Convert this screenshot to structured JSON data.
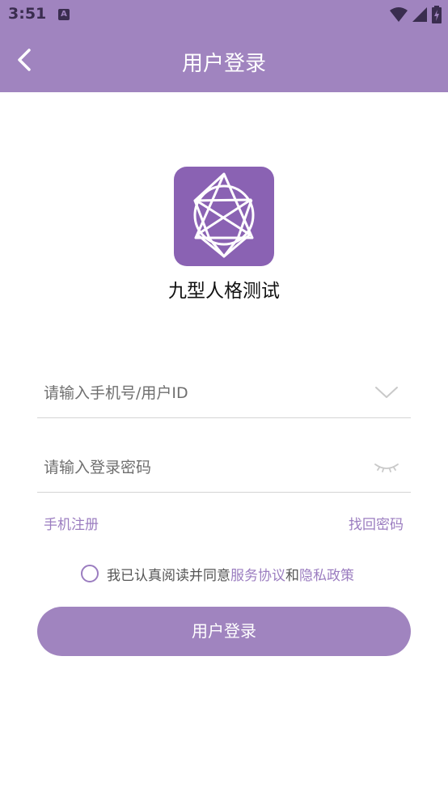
{
  "status_bar": {
    "time": "3:51",
    "notification_letter": "A"
  },
  "header": {
    "title": "用户登录"
  },
  "app": {
    "name": "九型人格测试"
  },
  "form": {
    "phone_placeholder": "请输入手机号/用户ID",
    "password_placeholder": "请输入登录密码"
  },
  "links": {
    "register": "手机注册",
    "forgot": "找回密码"
  },
  "agreement": {
    "prefix": "我已认真阅读并同意",
    "service": "服务协议",
    "and": "和",
    "privacy": "隐私政策"
  },
  "login_button": "用户登录",
  "colors": {
    "primary": "#a084bf",
    "logo": "#8a62b3",
    "link": "#9b7dc0"
  }
}
